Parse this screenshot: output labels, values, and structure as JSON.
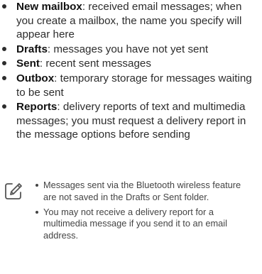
{
  "folders": [
    {
      "term": "New mailbox",
      "description": ": received email messages; when you create a mailbox, the name you specify will appear here"
    },
    {
      "term": "Drafts",
      "description": ": messages you have not yet sent"
    },
    {
      "term": "Sent",
      "description": ": recent sent messages"
    },
    {
      "term": "Outbox",
      "description": ": temporary storage for messages waiting to be sent"
    },
    {
      "term": "Reports",
      "description": ": delivery reports of text and multimedia messages; you must request a delivery report in the message options before sending"
    }
  ],
  "notes": [
    "Messages sent via the Bluetooth wireless feature are not saved in the Drafts or Sent folder.",
    "You may not receive a delivery report for a multimedia message if you send it to an email address."
  ],
  "icons": {
    "note": "pencil-note-icon"
  }
}
